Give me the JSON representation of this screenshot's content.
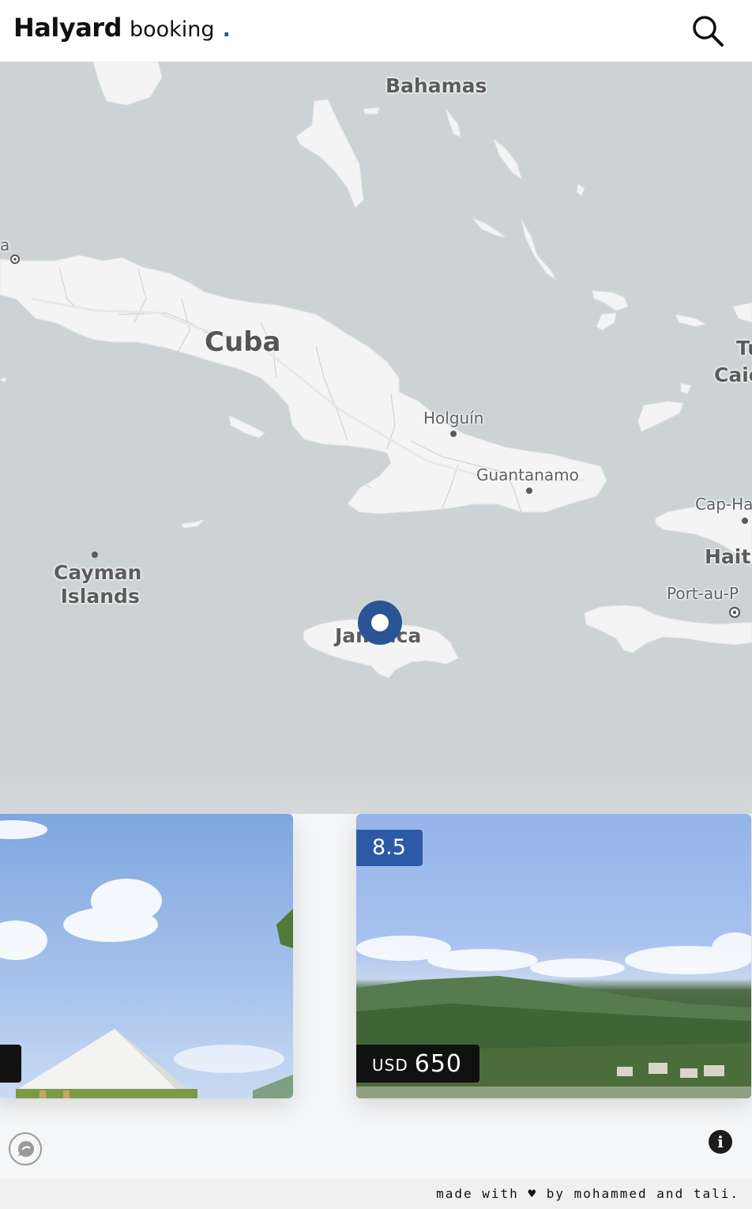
{
  "header": {
    "brand_name": "Halyard",
    "brand_sub": "booking",
    "brand_dot": "."
  },
  "map": {
    "labels": {
      "bahamas": "Bahamas",
      "cuba": "Cuba",
      "holguin": "Holguín",
      "guantanamo": "Guantanamo",
      "cayman": "Cayman\nIslands",
      "cayman_line1": "Cayman",
      "cayman_line2": "Islands",
      "jamaica": "Jamaica",
      "haiti": "Haiti",
      "cap_haitien": "Cap-Ha",
      "port_au_prince": "Port-au-P",
      "turks_line1": "Tu",
      "turks_line2": "Caic",
      "havana_edge": "a"
    },
    "colors": {
      "water": "#cdd3d5",
      "land": "#f4f4f4",
      "marker": "#2b5496"
    }
  },
  "cards": [
    {
      "name": "listing-left",
      "price_visible": false
    },
    {
      "name": "listing-right",
      "score": "8.5",
      "currency": "USD",
      "price": "650"
    }
  ],
  "footer": {
    "text": "made with ♥ by mohammed and tali."
  },
  "icons": {
    "search": "search-icon",
    "chat": "chat-icon",
    "info": "info-icon",
    "marker": "location-marker-icon"
  }
}
